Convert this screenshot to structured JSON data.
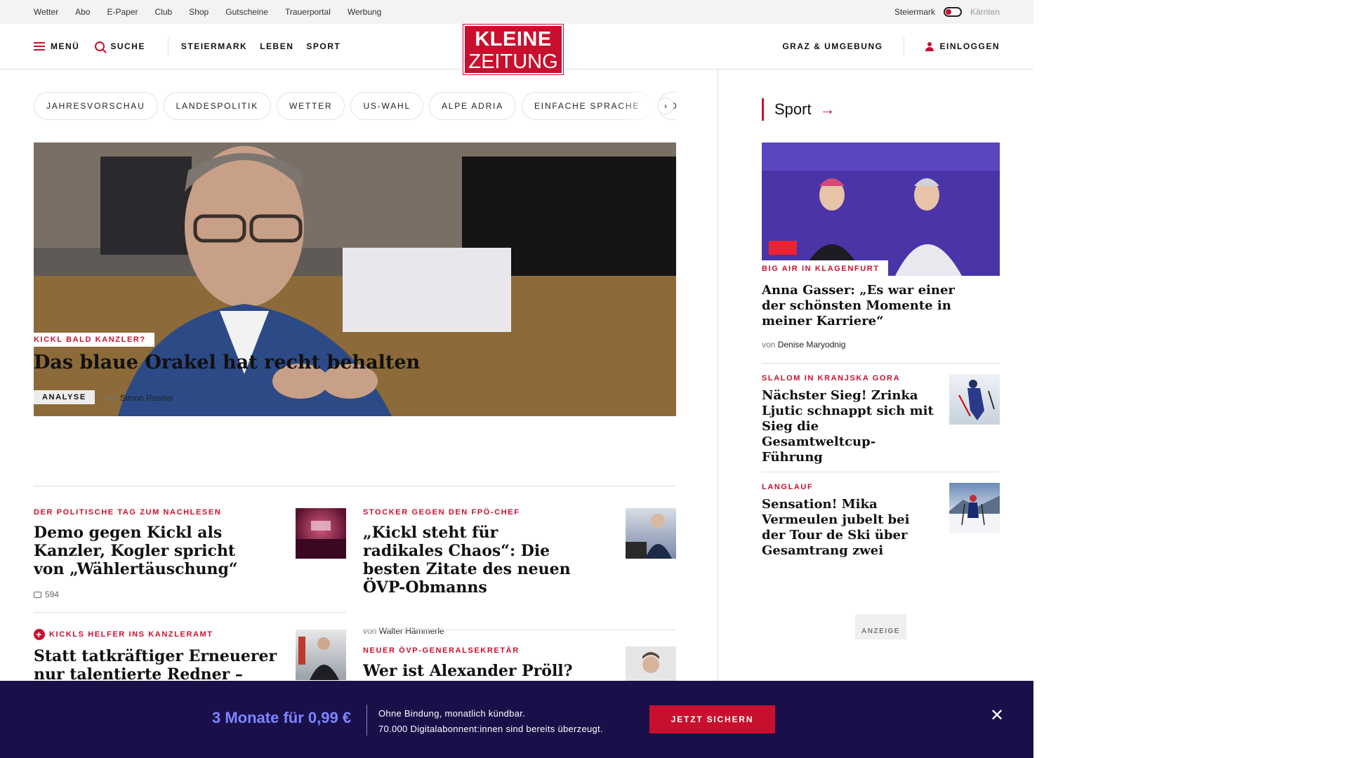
{
  "utility": {
    "links": [
      "Wetter",
      "Abo",
      "E-Paper",
      "Club",
      "Shop",
      "Gutscheine",
      "Trauerportal",
      "Werbung"
    ],
    "region_active": "Steiermark",
    "region_inactive": "Kärnten"
  },
  "header": {
    "menu_label": "MENÜ",
    "search_label": "SUCHE",
    "sections": [
      "STEIERMARK",
      "LEBEN",
      "SPORT"
    ],
    "logo_line1": "KLEINE",
    "logo_line2": "ZEITUNG",
    "location_label": "GRAZ & UMGEBUNG",
    "login_label": "EINLOGGEN",
    "accent_color": "#c8102e"
  },
  "chips": [
    "JAHRESVORSCHAU",
    "LANDESPOLITIK",
    "WETTER",
    "US-WAHL",
    "ALPE ADRIA",
    "EINFACHE SPRACHE",
    "DOS"
  ],
  "hero": {
    "kicker": "KICKL BALD KANZLER?",
    "title": "Das blaue Orakel hat recht behalten",
    "badge": "ANALYSE",
    "by_prefix": "von",
    "author": "Simon Rosner"
  },
  "articles": [
    {
      "kicker": "DER POLITISCHE TAG ZUM NACHLESEN",
      "title": "Demo gegen Kickl als Kanzler, Kogler spricht von „Wählertäuschung“",
      "comments": "594"
    },
    {
      "kicker": "STOCKER GEGEN DEN FPÖ-CHEF",
      "title": "„Kickl steht für radikales Chaos“: Die besten Zitate des neuen ÖVP-Obmanns",
      "by_prefix": "von",
      "author": "Walter Hämmerle"
    },
    {
      "kicker": "KICKLS HELFER INS KANZLERAMT",
      "title": "Statt tatkräftiger Erneuerer nur talentierte Redner – und am",
      "premium": true
    },
    {
      "kicker": "NEUER ÖVP-GENERALSEKRETÄR",
      "title": "Wer ist Alexander Pröll?"
    }
  ],
  "sidebar": {
    "heading": "Sport",
    "main": {
      "kicker": "BIG AIR IN KLAGENFURT",
      "title": "Anna Gasser: „Es war einer der schönsten Momente in meiner Karriere“",
      "by_prefix": "von",
      "author": "Denise Maryodnig"
    },
    "items": [
      {
        "kicker": "SLALOM IN KRANJSKA GORA",
        "title": "Nächster Sieg! Zrinka Ljutic schnappt sich mit Sieg die Gesamtweltcup-Führung"
      },
      {
        "kicker": "LANGLAUF",
        "title": "Sensation! Mika Vermeulen jubelt bei der Tour de Ski über Gesamtrang zwei"
      }
    ],
    "ad_label": "ANZEIGE"
  },
  "promo": {
    "price": "3 Monate für 0,99 €",
    "line1": "Ohne Bindung, monatlich kündbar.",
    "line2": "70.000 Digitalabonnent:innen sind bereits überzeugt.",
    "cta": "JETZT SICHERN",
    "background": "#1b0f4a"
  }
}
